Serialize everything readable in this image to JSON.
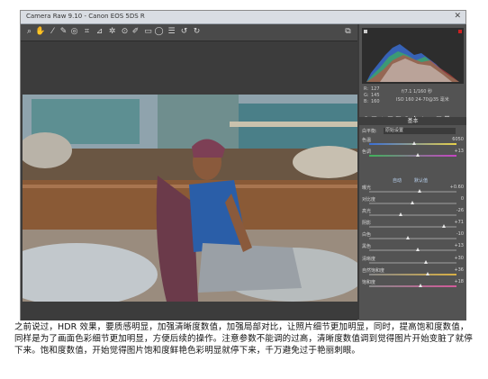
{
  "window": {
    "title": "Camera Raw 9.10 - Canon EOS 5DS R"
  },
  "toolbar": {
    "tools": [
      "zoom-icon",
      "hand-icon",
      "white-balance-icon",
      "color-sampler-icon",
      "target-adjust-icon",
      "crop-icon",
      "straighten-icon",
      "spot-removal-icon",
      "red-eye-icon",
      "adjustment-brush-icon",
      "graduated-filter-icon",
      "radial-filter-icon",
      "preferences-icon",
      "rotate-left-icon",
      "rotate-right-icon"
    ]
  },
  "panel": {
    "readout": {
      "r_label": "R:",
      "r_value": "127",
      "g_label": "G:",
      "g_value": "145",
      "b_label": "B:",
      "b_value": "160",
      "exposure": "f/7.1 1/160 秒",
      "iso": "ISO 160  24-70@35 毫米"
    },
    "section_title": "基本",
    "white_balance_label": "白平衡:",
    "white_balance_value": "原始设置",
    "sliders": [
      {
        "label": "色温",
        "value": "6050",
        "pos": 0.52
      },
      {
        "label": "色调",
        "value": "+13",
        "pos": 0.56
      },
      {
        "label": "曝光",
        "value": "+0.60",
        "pos": 0.58
      },
      {
        "label": "对比度",
        "value": "0",
        "pos": 0.5
      },
      {
        "label": "高光",
        "value": "-26",
        "pos": 0.37
      },
      {
        "label": "阴影",
        "value": "+71",
        "pos": 0.86
      },
      {
        "label": "白色",
        "value": "-10",
        "pos": 0.45
      },
      {
        "label": "黑色",
        "value": "+13",
        "pos": 0.56
      },
      {
        "label": "清晰度",
        "value": "+30",
        "pos": 0.65
      },
      {
        "label": "自然饱和度",
        "value": "+36",
        "pos": 0.68
      },
      {
        "label": "饱和度",
        "value": "+18",
        "pos": 0.59
      }
    ],
    "auto_label": "自动",
    "default_label": "默认值"
  },
  "caption": "之前说过，HDR 效果，要质感明显，加强清晰度数值，加强局部对比，让照片细节更加明显，同时，提高饱和度数值，同样是为了画面色彩细节更加明显，方便后续的操作。注意参数不能调的过高，清晰度数值调到觉得图片开始变脏了就停下来。饱和度数值，开始觉得图片饱和度鲜艳色彩明显就停下来，千万避免过于艳丽刺眼。",
  "colors": {
    "accent": "#4a7fd0",
    "panel_bg": "#535353",
    "canvas_bg": "#3c3c3c"
  }
}
